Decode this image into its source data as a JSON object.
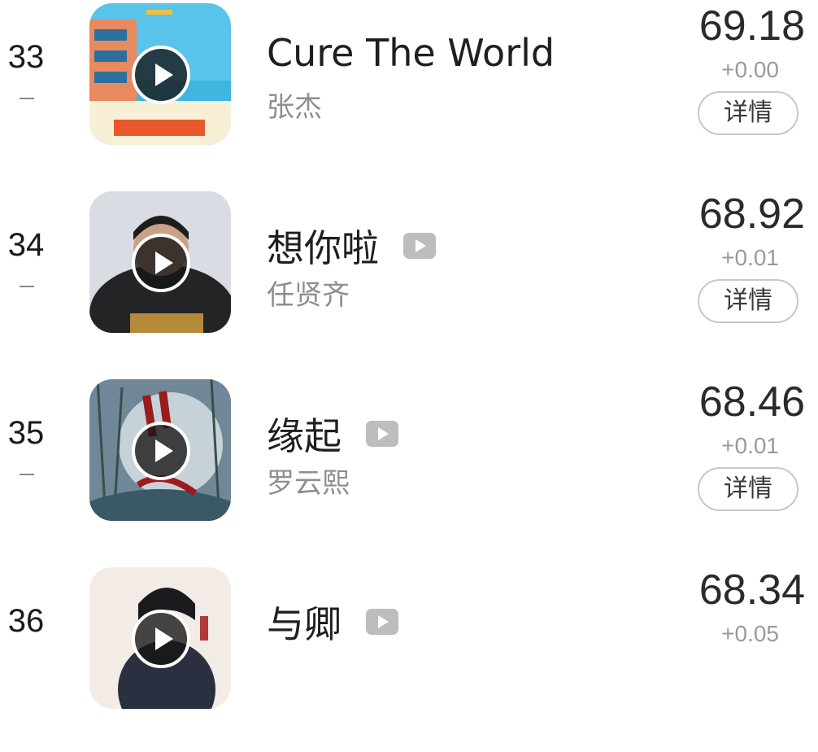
{
  "list": {
    "items": [
      {
        "rank": "33",
        "title": "Cure The World",
        "artist": "张杰",
        "score": "69.18",
        "delta": "+0.00",
        "detail_label": "详情",
        "has_mv": false,
        "cover_icon": "album-cover-risk-it-all"
      },
      {
        "rank": "34",
        "title": "想你啦",
        "artist": "任贤齐",
        "score": "68.92",
        "delta": "+0.01",
        "detail_label": "详情",
        "has_mv": true,
        "cover_icon": "album-cover-portrait"
      },
      {
        "rank": "35",
        "title": "缘起",
        "artist": "罗云熙",
        "score": "68.46",
        "delta": "+0.01",
        "detail_label": "详情",
        "has_mv": true,
        "cover_icon": "album-cover-bamboo"
      },
      {
        "rank": "36",
        "title": "与卿",
        "artist": "",
        "score": "68.34",
        "delta": "+0.05",
        "detail_label": "",
        "has_mv": true,
        "cover_icon": "album-cover-portrait-light"
      }
    ]
  },
  "icons": {
    "play": "play-icon",
    "mv": "mv-icon",
    "trend_flat": "trend-flat-icon"
  },
  "colors": {
    "title": "#1f1f1f",
    "artist": "#8e8e8e",
    "score": "#2a2a2a",
    "delta": "#9a9a9a",
    "mv_icon": "#bdbdbd",
    "button_border": "#c8c8c8"
  }
}
